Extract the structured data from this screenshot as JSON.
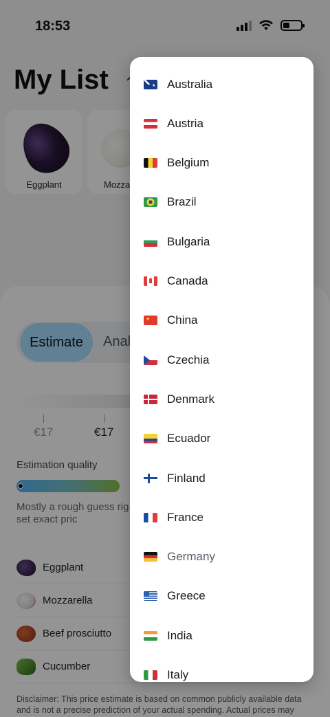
{
  "status": {
    "time": "18:53"
  },
  "header": {
    "title": "My List",
    "caret": "⌃",
    "right_glyph": "›"
  },
  "cards": [
    {
      "label": "Eggplant",
      "icon": "eggplant-image"
    },
    {
      "label": "Mozza",
      "icon": "mozzarella-image"
    }
  ],
  "estimate": {
    "tabs": [
      "Estimate",
      "Anal"
    ],
    "prices": [
      "€17",
      "€17"
    ],
    "quality_label": "Estimation quality",
    "quality_level": 0.0,
    "quality_desc": "Mostly a rough guess rig smarter, or set exact pric"
  },
  "items": [
    {
      "name": "Eggplant",
      "icon": "eggplant-icon"
    },
    {
      "name": "Mozzarella",
      "icon": "mozzarella-icon"
    },
    {
      "name": "Beef prosciutto",
      "icon": "beef-icon"
    },
    {
      "name": "Cucumber",
      "icon": "cucumber-icon"
    }
  ],
  "disclaimer": "Disclaimer: This price estimate is based on common publicly available data and is not a precise prediction of your actual spending. Actual prices may",
  "dropdown": {
    "selected": "Germany",
    "options": [
      {
        "label": "Australia",
        "flag": "flag-australia-icon"
      },
      {
        "label": "Austria",
        "flag": "flag-austria-icon"
      },
      {
        "label": "Belgium",
        "flag": "flag-belgium-icon"
      },
      {
        "label": "Brazil",
        "flag": "flag-brazil-icon"
      },
      {
        "label": "Bulgaria",
        "flag": "flag-bulgaria-icon"
      },
      {
        "label": "Canada",
        "flag": "flag-canada-icon"
      },
      {
        "label": "China",
        "flag": "flag-china-icon"
      },
      {
        "label": "Czechia",
        "flag": "flag-czechia-icon"
      },
      {
        "label": "Denmark",
        "flag": "flag-denmark-icon"
      },
      {
        "label": "Ecuador",
        "flag": "flag-ecuador-icon"
      },
      {
        "label": "Finland",
        "flag": "flag-finland-icon"
      },
      {
        "label": "France",
        "flag": "flag-france-icon"
      },
      {
        "label": "Germany",
        "flag": "flag-germany-icon"
      },
      {
        "label": "Greece",
        "flag": "flag-greece-icon"
      },
      {
        "label": "India",
        "flag": "flag-india-icon"
      },
      {
        "label": "Italy",
        "flag": "flag-italy-icon"
      }
    ]
  },
  "colors": {
    "accent": "#a8dcff",
    "overlay": "rgba(0,0,0,0.42)"
  }
}
